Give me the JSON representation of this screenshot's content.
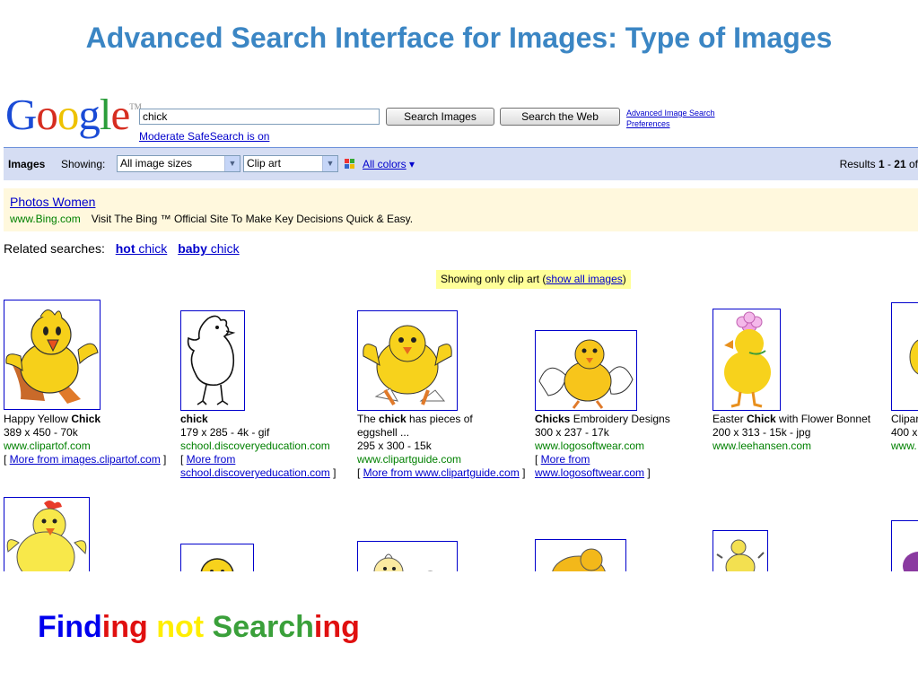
{
  "slide": {
    "title": "Advanced Search Interface for Images: Type of Images",
    "tagline_parts": [
      {
        "text": "Find",
        "color": "#0000ee"
      },
      {
        "text": "ing ",
        "color": "#e01010"
      },
      {
        "text": "not ",
        "color": "#ffee00"
      },
      {
        "text": "Search",
        "color": "#3aa03a"
      },
      {
        "text": "ing",
        "color": "#e01010"
      }
    ]
  },
  "header": {
    "logo_letters": [
      {
        "ch": "G",
        "color": "#1a4bd6"
      },
      {
        "ch": "o",
        "color": "#d62d20"
      },
      {
        "ch": "o",
        "color": "#eec200"
      },
      {
        "ch": "g",
        "color": "#1a4bd6"
      },
      {
        "ch": "l",
        "color": "#2a9d3a"
      },
      {
        "ch": "e",
        "color": "#d62d20"
      }
    ],
    "logo_tm": "TM",
    "query": "chick",
    "search_images_label": "Search Images",
    "search_web_label": "Search the Web",
    "safesearch": "Moderate SafeSearch is on",
    "advanced_link": "Advanced Image Search",
    "preferences_link": "Preferences"
  },
  "toolbar": {
    "images_label": "Images",
    "showing_label": "Showing:",
    "size_selected": "All image sizes",
    "type_selected": "Clip art",
    "colors_label": "All colors",
    "results_prefix": "Results ",
    "results_from": "1",
    "results_dash": " - ",
    "results_to": "21",
    "results_suffix": " of"
  },
  "ad": {
    "title": "Photos Women",
    "url": "www.Bing.com",
    "text": "Visit The Bing ™ Official Site To Make Key Decisions Quick & Easy."
  },
  "related": {
    "label": "Related searches:",
    "items": [
      {
        "bold": "hot",
        "rest": " chick"
      },
      {
        "bold": "baby",
        "rest": " chick"
      }
    ]
  },
  "clip_notice": {
    "prefix": "Showing only clip art (",
    "link": "show all images",
    "suffix": ")"
  },
  "results": [
    {
      "title_pre": "Happy Yellow ",
      "title_bold": "Chick",
      "title_post": "",
      "title_line2": "",
      "dims": "389 x 450 - 70k",
      "url": "www.clipartof.com",
      "more_pre": "[ ",
      "more_link": "More from images.clipartof.com",
      "more_link2": "",
      "more_post": " ]"
    },
    {
      "title_pre": "",
      "title_bold": "chick",
      "title_post": "",
      "title_line2": "",
      "dims": "179 x 285 - 4k - gif",
      "url": "school.discoveryeducation.com",
      "more_pre": "[ ",
      "more_link": "More from",
      "more_link2": "school.discoveryeducation.com",
      "more_post": " ]"
    },
    {
      "title_pre": "The ",
      "title_bold": "chick",
      "title_post": " has pieces of",
      "title_line2": "eggshell ...",
      "dims": "295 x 300 - 15k",
      "url": "www.clipartguide.com",
      "more_pre": "[ ",
      "more_link": "More from www.clipartguide.com",
      "more_link2": "",
      "more_post": " ]"
    },
    {
      "title_pre": "",
      "title_bold": "Chicks",
      "title_post": " Embroidery Designs",
      "title_line2": "",
      "dims": "300 x 237 - 17k",
      "url": "www.logosoftwear.com",
      "more_pre": "[ ",
      "more_link": "More from",
      "more_link2": "www.logosoftwear.com",
      "more_post": " ]"
    },
    {
      "title_pre": "Easter ",
      "title_bold": "Chick",
      "title_post": " with Flower Bonnet",
      "title_line2": "",
      "dims": "200 x 313 - 15k - jpg",
      "url": "www.leehansen.com",
      "more_pre": "",
      "more_link": "",
      "more_link2": "",
      "more_post": ""
    },
    {
      "title_pre": "Clipar",
      "title_bold": "",
      "title_post": "",
      "title_line2": "",
      "dims": "400 x",
      "url": "www.",
      "more_pre": "",
      "more_link": "",
      "more_link2": "",
      "more_post": ""
    }
  ]
}
